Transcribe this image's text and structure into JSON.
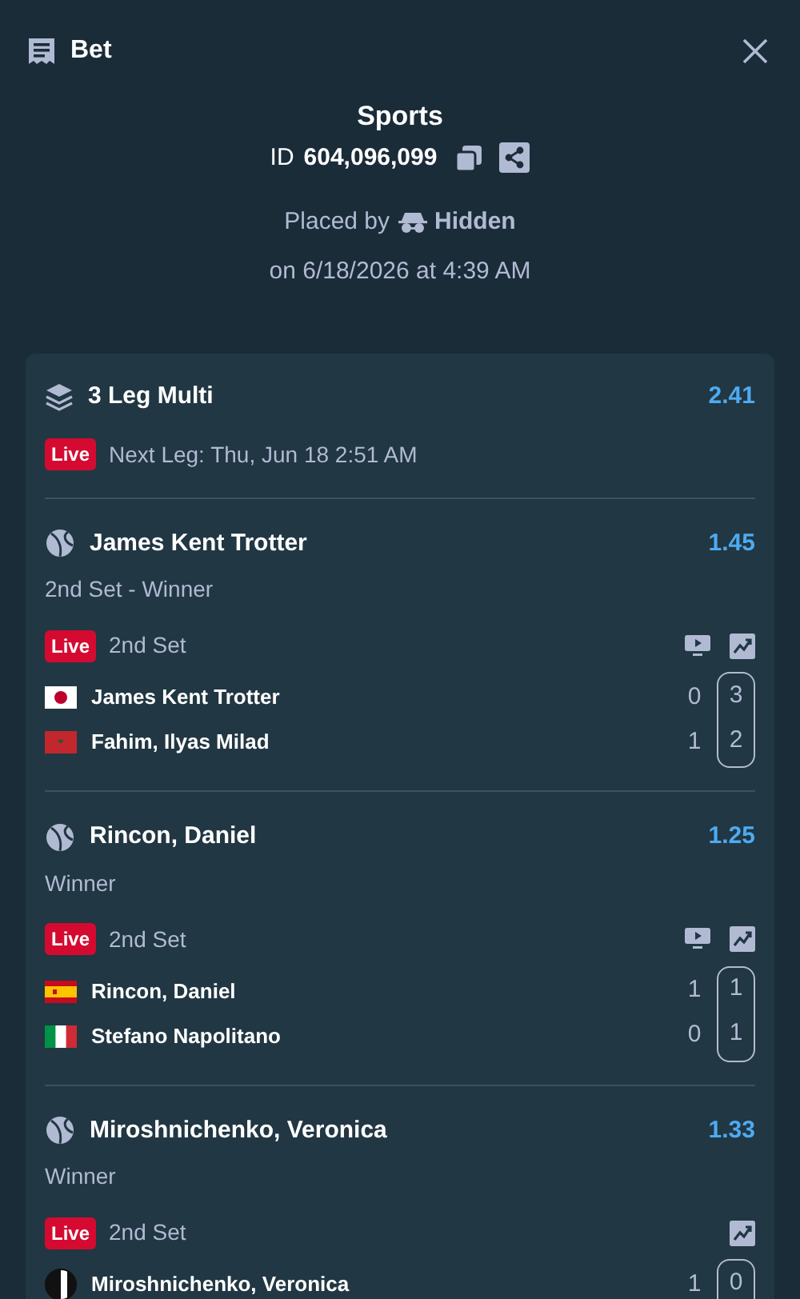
{
  "header": {
    "title": "Bet"
  },
  "summary": {
    "category": "Sports",
    "id_label": "ID",
    "id_value": "604,096,099",
    "placed_by_label": "Placed by",
    "placed_by_name": "Hidden",
    "placed_on": "on 6/18/2026 at 4:39 AM"
  },
  "multi": {
    "title": "3 Leg Multi",
    "odds": "2.41",
    "badge": "Live",
    "next_leg": "Next Leg: Thu, Jun 18 2:51 AM"
  },
  "legs": [
    {
      "selection": "James Kent Trotter",
      "odds": "1.45",
      "market": "2nd Set - Winner",
      "badge": "Live",
      "period": "2nd Set",
      "stream": true,
      "stats": true,
      "players": [
        {
          "name": "James Kent Trotter",
          "kind": "japan",
          "score": "0",
          "set_score": "3"
        },
        {
          "name": "Fahim, Ilyas Milad",
          "kind": "morocco",
          "score": "1",
          "set_score": "2"
        }
      ]
    },
    {
      "selection": "Rincon, Daniel",
      "odds": "1.25",
      "market": "Winner",
      "badge": "Live",
      "period": "2nd Set",
      "stream": true,
      "stats": true,
      "players": [
        {
          "name": "Rincon, Daniel",
          "kind": "spain",
          "score": "1",
          "set_score": "1"
        },
        {
          "name": "Stefano Napolitano",
          "kind": "italy",
          "score": "0",
          "set_score": "1"
        }
      ]
    },
    {
      "selection": "Miroshnichenko, Veronica",
      "odds": "1.33",
      "market": "Winner",
      "badge": "Live",
      "period": "2nd Set",
      "stream": false,
      "stats": true,
      "players": [
        {
          "name": "Miroshnichenko, Veronica",
          "kind": "neutral",
          "score": "1",
          "set_score": "0"
        }
      ]
    }
  ]
}
